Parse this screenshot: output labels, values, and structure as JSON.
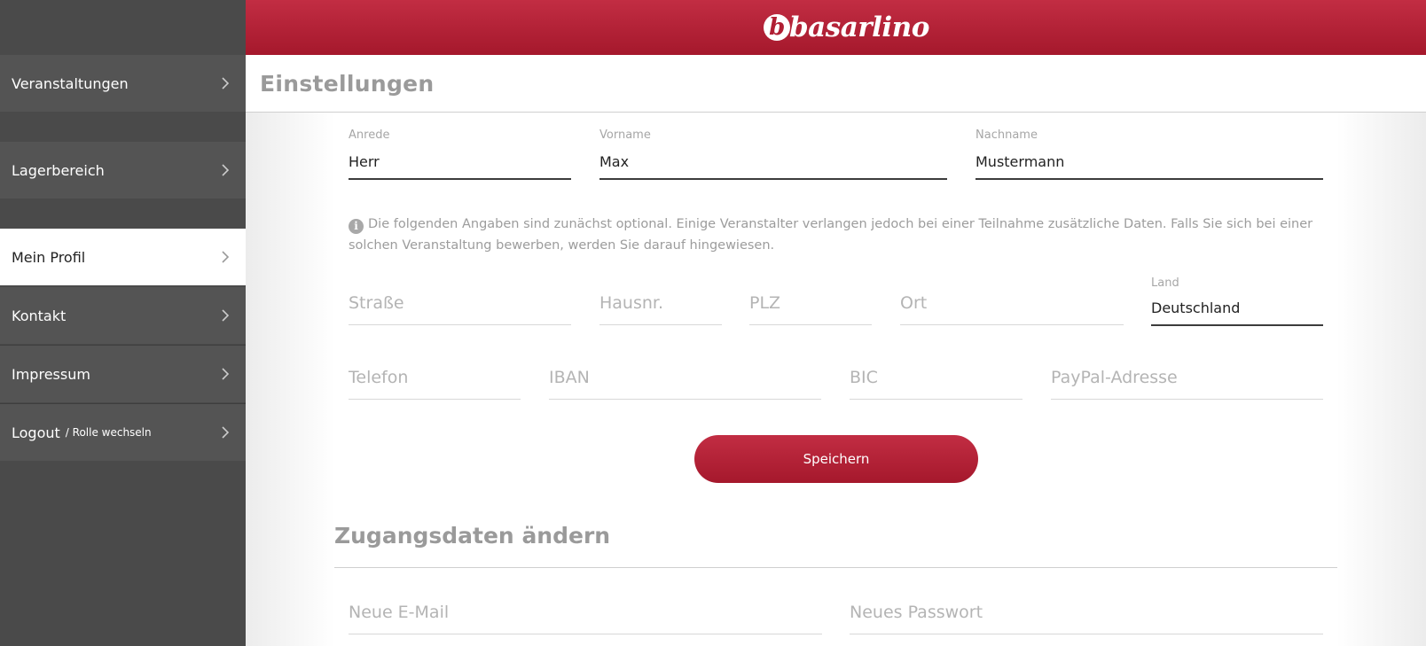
{
  "sidebar": {
    "items": [
      {
        "label": "Veranstaltungen"
      },
      {
        "label": "Lagerbereich"
      },
      {
        "label": "Mein Profil"
      },
      {
        "label": "Kontakt"
      },
      {
        "label": "Impressum"
      },
      {
        "label": "Logout",
        "sub": "/ Rolle wechseln"
      }
    ]
  },
  "header": {
    "logo_text": "basarlino",
    "logo_mark": "b"
  },
  "page": {
    "title": "Einstellungen"
  },
  "profile": {
    "anrede": {
      "label": "Anrede",
      "value": "Herr"
    },
    "vorname": {
      "label": "Vorname",
      "value": "Max"
    },
    "nachname": {
      "label": "Nachname",
      "value": "Mustermann"
    },
    "info_text": "Die folgenden Angaben sind zunächst optional. Einige Veranstalter verlangen jedoch bei einer Teilnahme zusätzliche Daten. Falls Sie sich bei einer solchen Veranstaltung bewerben, werden Sie darauf hingewiesen.",
    "strasse": {
      "placeholder": "Straße"
    },
    "hausnr": {
      "placeholder": "Hausnr."
    },
    "plz": {
      "placeholder": "PLZ"
    },
    "ort": {
      "placeholder": "Ort"
    },
    "land": {
      "label": "Land",
      "value": "Deutschland"
    },
    "telefon": {
      "placeholder": "Telefon"
    },
    "iban": {
      "placeholder": "IBAN"
    },
    "bic": {
      "placeholder": "BIC"
    },
    "paypal": {
      "placeholder": "PayPal-Adresse"
    },
    "save_label": "Speichern"
  },
  "access": {
    "title": "Zugangsdaten ändern",
    "email": {
      "placeholder": "Neue E-Mail"
    },
    "password": {
      "placeholder": "Neues Passwort"
    }
  },
  "colors": {
    "brand": "#b01e33",
    "sidebar": "#4a4a4a"
  }
}
